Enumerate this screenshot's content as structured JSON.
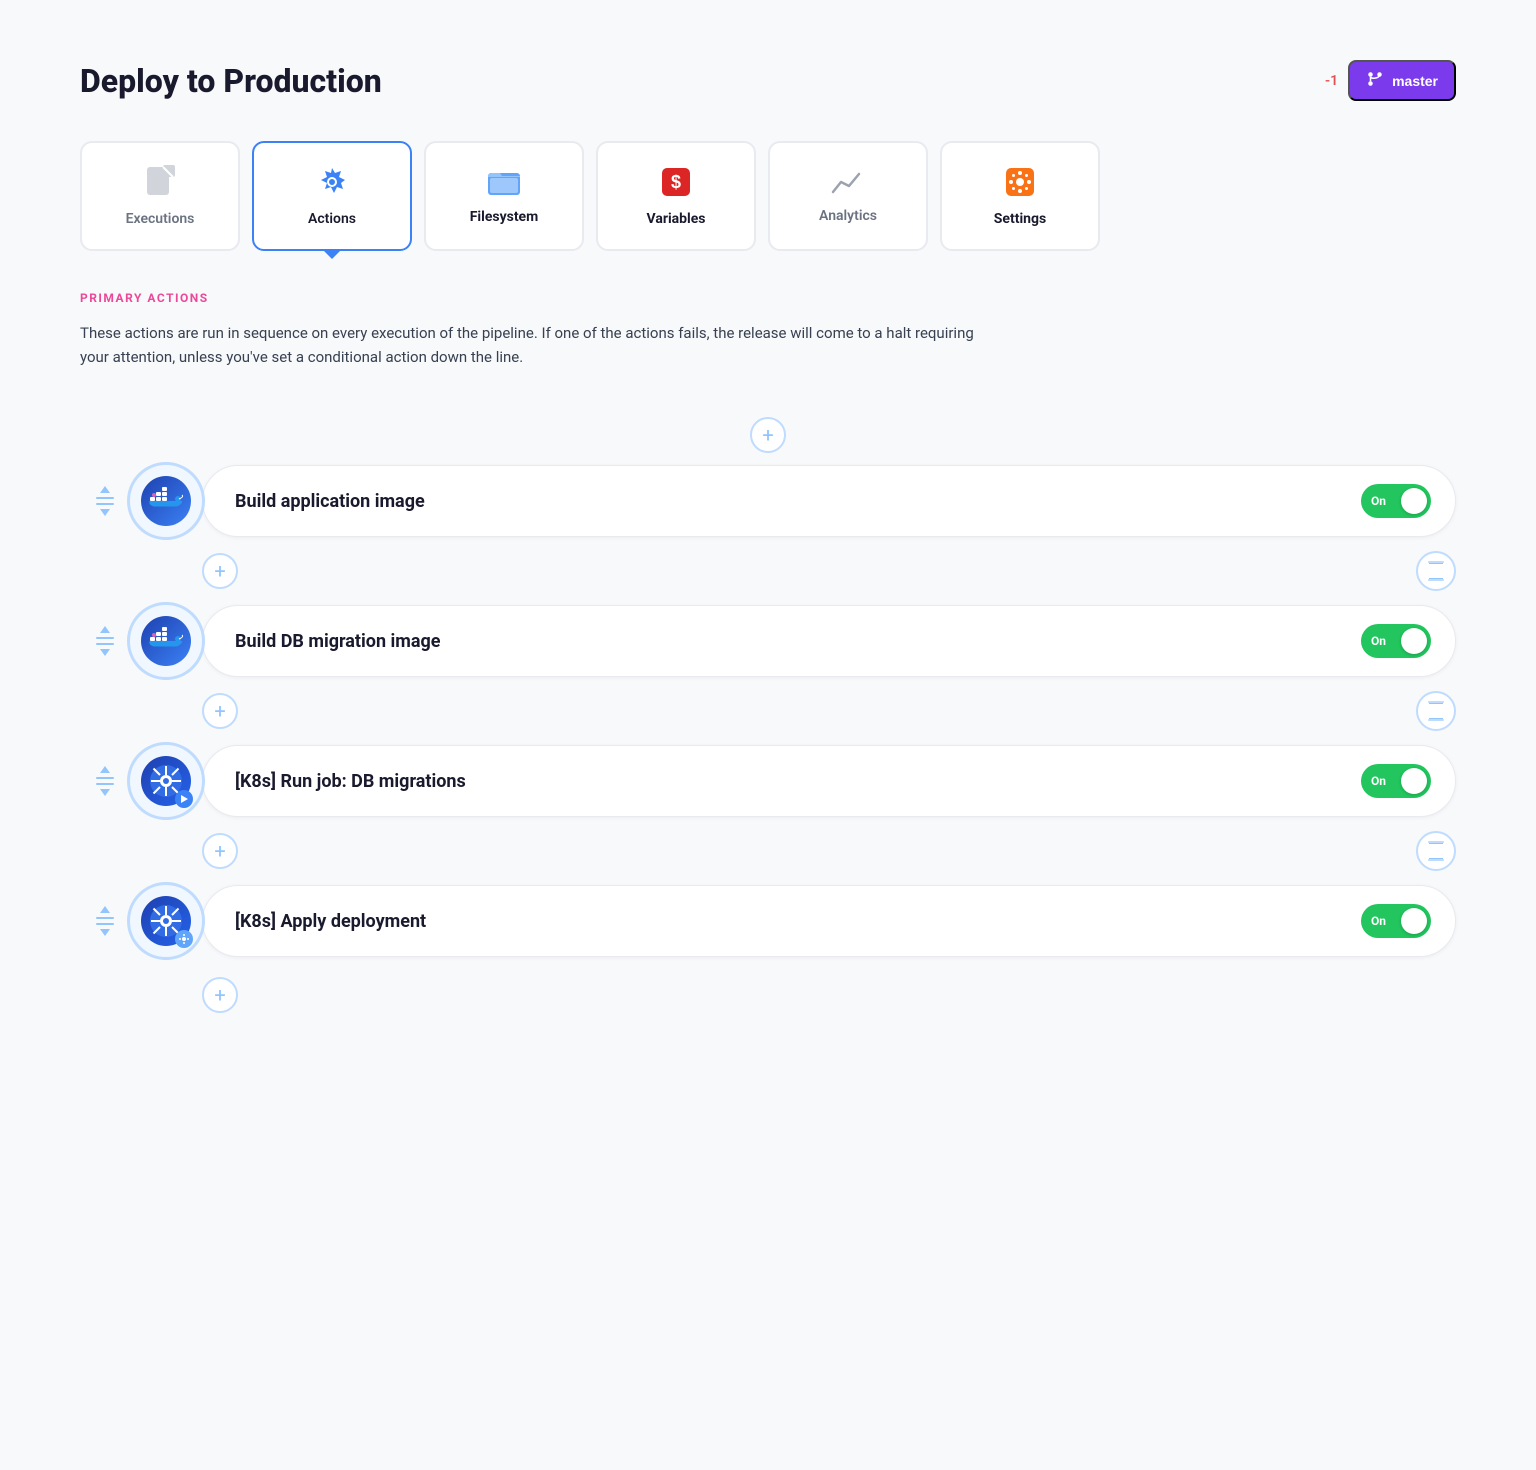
{
  "page": {
    "title": "Deploy to Production",
    "badge": "-1",
    "branch": "master"
  },
  "tabs": [
    {
      "id": "executions",
      "label": "Executions",
      "active": false,
      "bold": false,
      "icon": "📄"
    },
    {
      "id": "actions",
      "label": "Actions",
      "active": true,
      "bold": true,
      "icon": "⚙️"
    },
    {
      "id": "filesystem",
      "label": "Filesystem",
      "active": false,
      "bold": true,
      "icon": "📁"
    },
    {
      "id": "variables",
      "label": "Variables",
      "active": false,
      "bold": true,
      "icon": "💲"
    },
    {
      "id": "analytics",
      "label": "Analytics",
      "active": false,
      "bold": false,
      "icon": "📈"
    },
    {
      "id": "settings",
      "label": "Settings",
      "active": false,
      "bold": true,
      "icon": "🎛️"
    }
  ],
  "section": {
    "label": "PRIMARY ACTIONS",
    "description": "These actions are run in sequence on every execution of the pipeline. If one of the actions fails, the release will come to a halt requiring your attention, unless you've set a conditional action down the line."
  },
  "actions": [
    {
      "id": 1,
      "name": "Build application image",
      "toggle": "On",
      "type": "docker"
    },
    {
      "id": 2,
      "name": "Build DB migration image",
      "toggle": "On",
      "type": "docker"
    },
    {
      "id": 3,
      "name": "[K8s] Run job: DB migrations",
      "toggle": "On",
      "type": "k8s-run"
    },
    {
      "id": 4,
      "name": "[K8s] Apply deployment",
      "toggle": "On",
      "type": "k8s-apply"
    }
  ],
  "ui": {
    "add_label": "+",
    "toggle_on": "On",
    "branch_icon": "⑂"
  }
}
